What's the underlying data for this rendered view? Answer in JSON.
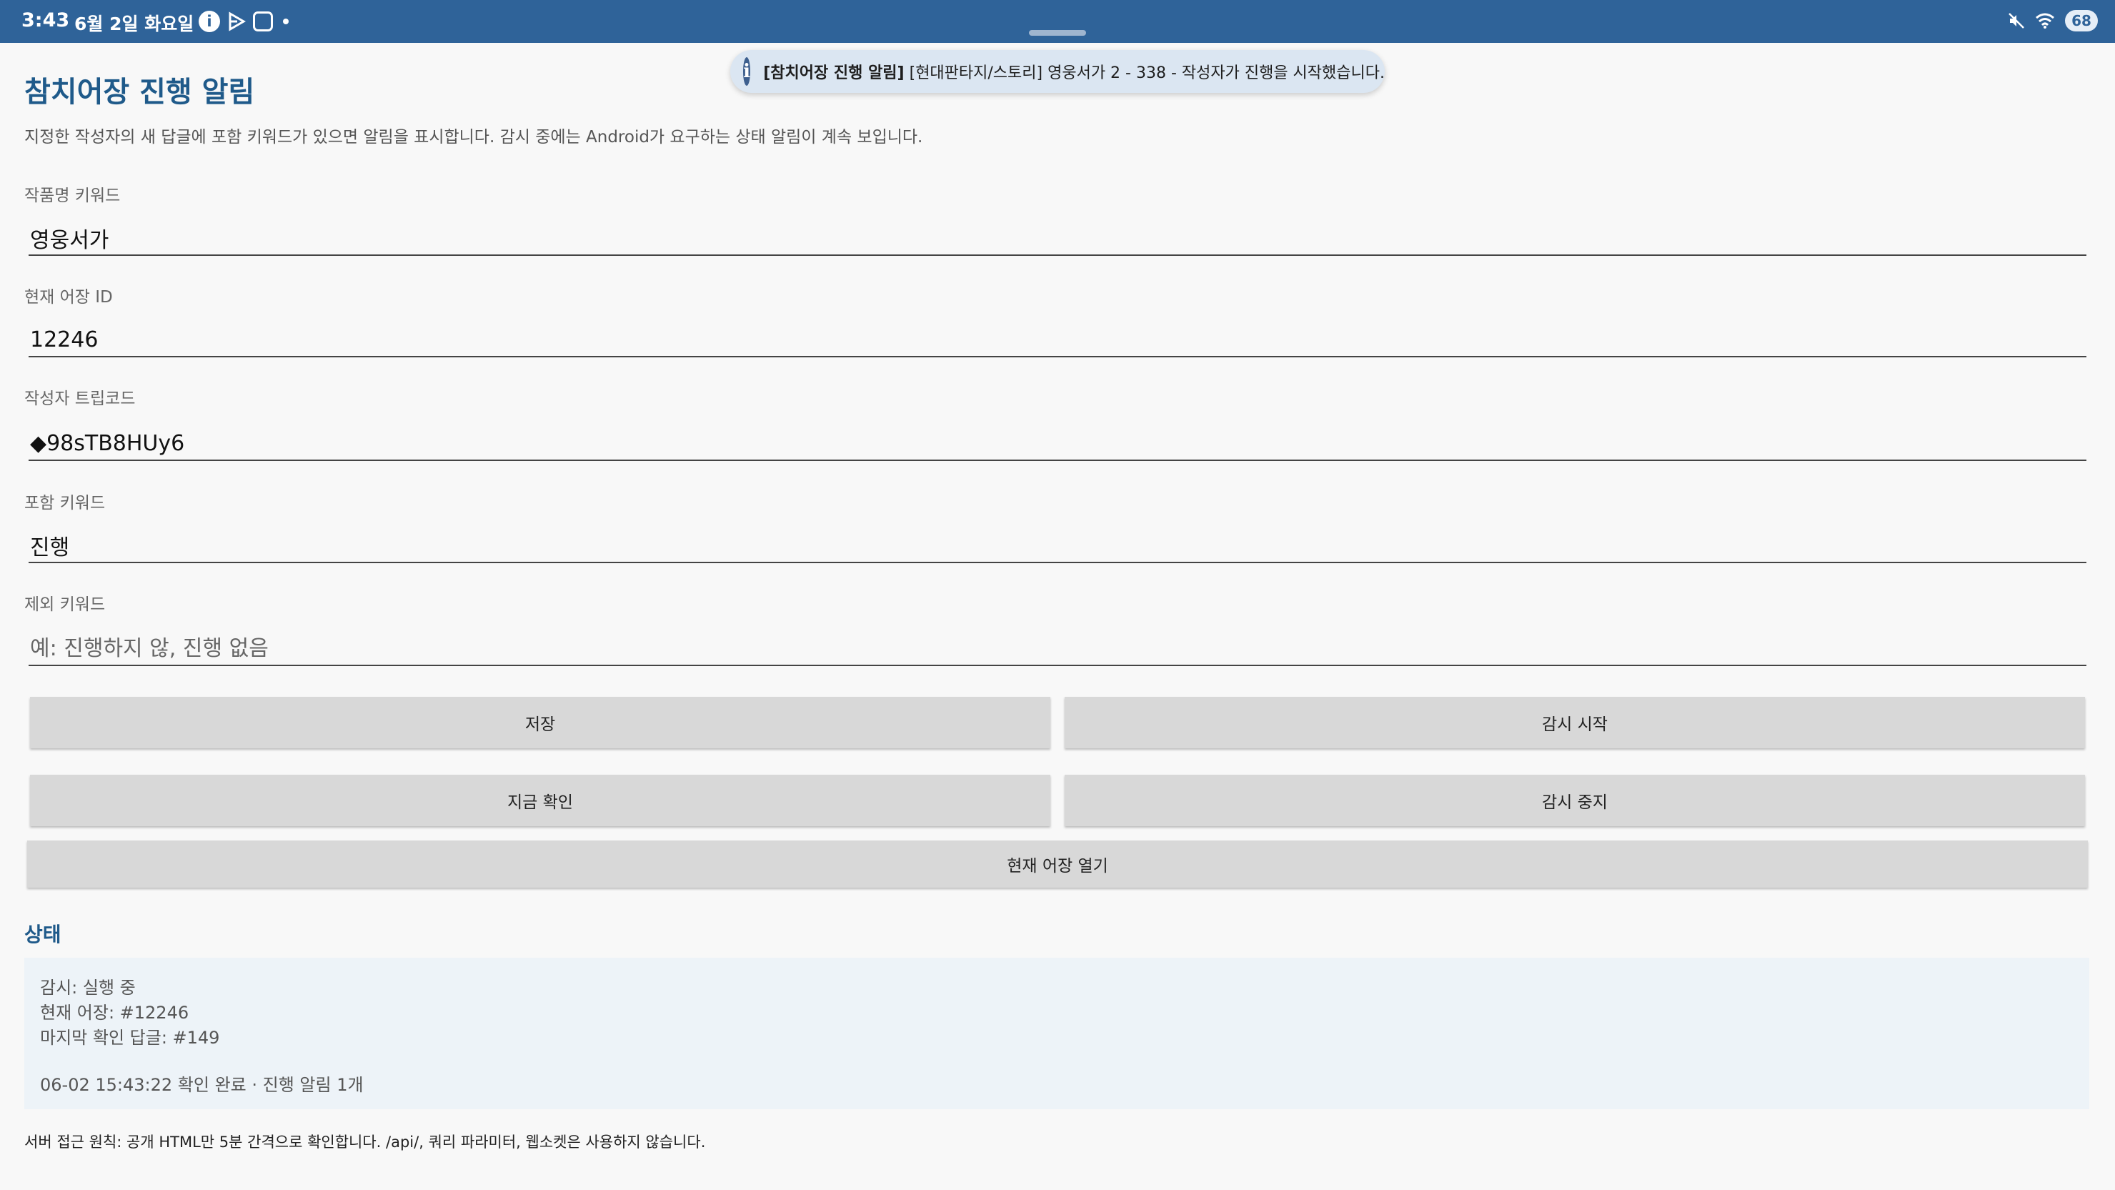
{
  "status_bar": {
    "time": "3:43",
    "date": "6월 2일 화요일",
    "battery": "68",
    "icons_left": [
      "info-icon",
      "play-icon",
      "message-icon",
      "dot-icon"
    ],
    "icons_right": [
      "mute-icon",
      "wifi-icon",
      "battery-icon"
    ],
    "background_color": "#2f6399"
  },
  "notification": {
    "app_name": "[참치어장 진행 알림]",
    "message": "[현대판타지/스토리] 영웅서가 2 - 338 - 작성자가 진행을 시작했습니다."
  },
  "page": {
    "title": "참치어장 진행 알림",
    "description": "지정한 작성자의 새 답글에 포함 키워드가 있으면 알림을 표시합니다. 감시 중에는 Android가 요구하는 상태 알림이 계속 보입니다.",
    "accent_color": "#1f5a8a"
  },
  "fields": {
    "title_keyword": {
      "label": "작품명 키워드",
      "value": "영웅서가"
    },
    "board_id": {
      "label": "현재 어장 ID",
      "value": "12246"
    },
    "author_tripcode": {
      "label": "작성자 트립코드",
      "value": "◆98sTB8HUy6"
    },
    "include_keyword": {
      "label": "포함 키워드",
      "value": "진행"
    },
    "exclude_keyword": {
      "label": "제외 키워드",
      "value": "",
      "placeholder": "예: 진행하지 않, 진행 없음"
    }
  },
  "buttons": {
    "save": "저장",
    "start_watch": "감시 시작",
    "check_now": "지금 확인",
    "stop_watch": "감시 중지",
    "open_board": "현재 어장 열기"
  },
  "status": {
    "heading": "상태",
    "watch": "감시: 실행 중",
    "current_board": "현재 어장: #12246",
    "last_checked": "마지막 확인 답글: #149",
    "log": "06-02 15:43:22 확인 완료 · 진행 알림 1개"
  },
  "footer": "서버 접근 원칙: 공개 HTML만 5분 간격으로 확인합니다. /api/, 쿼리 파라미터, 웹소켓은 사용하지 않습니다."
}
